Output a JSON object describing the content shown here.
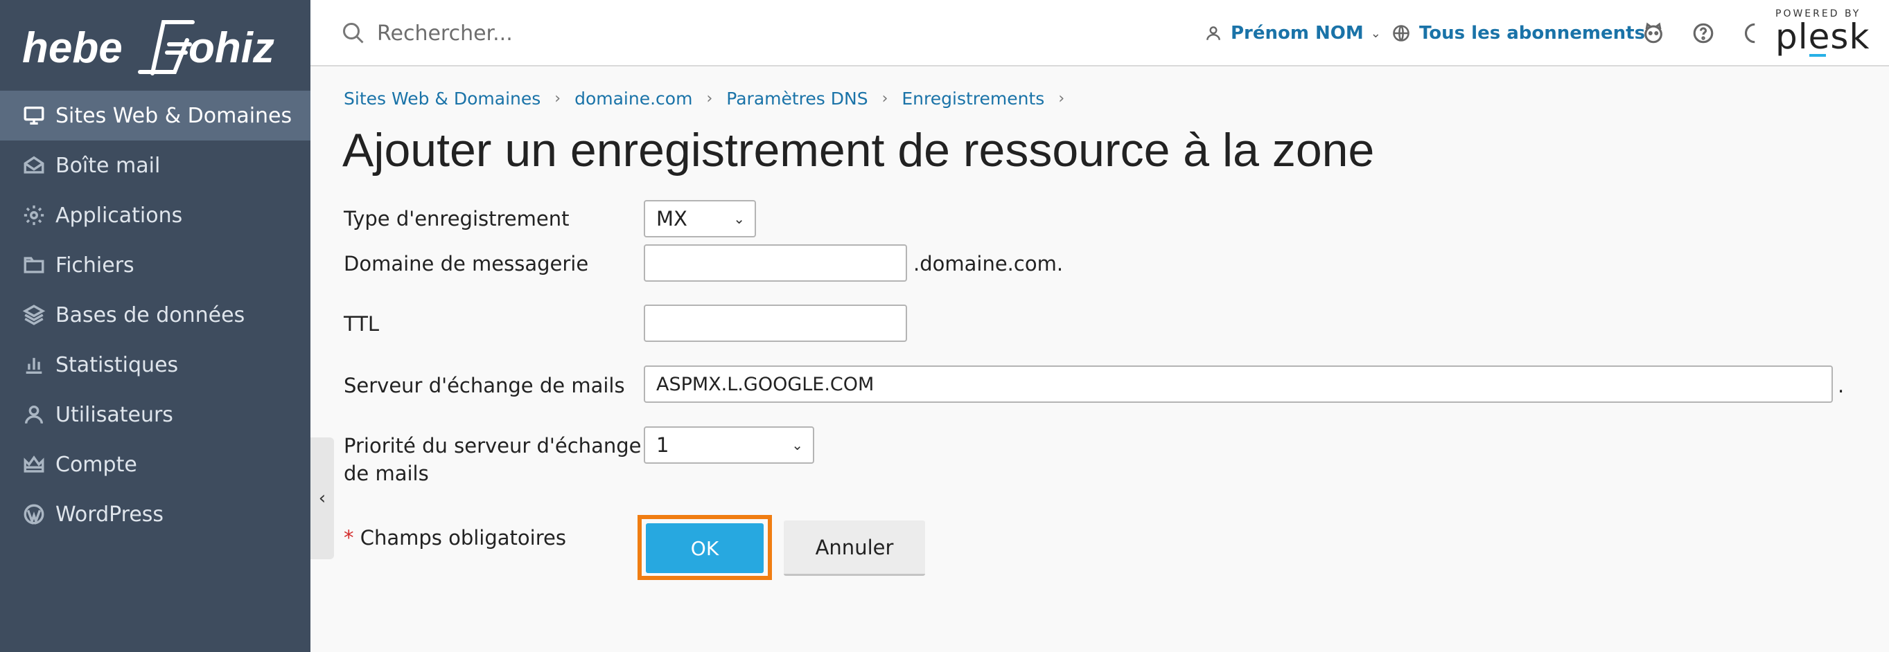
{
  "sidebar": {
    "logo": {
      "left": "hebe",
      "right": "ohiz"
    },
    "items": [
      {
        "label": "Sites Web & Domaines",
        "icon": "monitor-icon",
        "active": true
      },
      {
        "label": "Boîte mail",
        "icon": "mail-icon"
      },
      {
        "label": "Applications",
        "icon": "gear-icon"
      },
      {
        "label": "Fichiers",
        "icon": "folder-icon"
      },
      {
        "label": "Bases de données",
        "icon": "database-layers-icon"
      },
      {
        "label": "Statistiques",
        "icon": "bar-chart-icon"
      },
      {
        "label": "Utilisateurs",
        "icon": "user-icon"
      },
      {
        "label": "Compte",
        "icon": "crown-icon"
      },
      {
        "label": "WordPress",
        "icon": "wordpress-icon"
      }
    ],
    "collapse_glyph": "‹"
  },
  "header": {
    "search_placeholder": "Rechercher...",
    "user_name": "Prénom NOM",
    "subscriptions": "Tous les abonnements",
    "powered_by": "POWERED BY",
    "brand": "plesk"
  },
  "breadcrumb": [
    "Sites Web & Domaines",
    "domaine.com",
    "Paramètres DNS",
    "Enregistrements"
  ],
  "breadcrumb_sep": "›",
  "page_title": "Ajouter un enregistrement de ressource à la zone",
  "form": {
    "record_type": {
      "label": "Type d'enregistrement",
      "value": "MX"
    },
    "mail_domain": {
      "label": "Domaine de messagerie",
      "value": "",
      "suffix": ".domaine.com."
    },
    "ttl": {
      "label": "TTL",
      "value": ""
    },
    "mail_server": {
      "label": "Serveur d'échange de mails",
      "value": "ASPMX.L.GOOGLE.COM",
      "suffix": "."
    },
    "priority": {
      "label_line1": "Priorité du serveur d'échange",
      "label_line2": "de mails",
      "value": "1"
    },
    "required_star": "*",
    "required_text": "Champs obligatoires",
    "ok_label": "OK",
    "cancel_label": "Annuler"
  },
  "colors": {
    "sidebar": "#3e4c5e",
    "active": "#5a6b80",
    "link": "#1a73a8",
    "primary": "#27a8e0",
    "highlight": "#f07d12"
  }
}
